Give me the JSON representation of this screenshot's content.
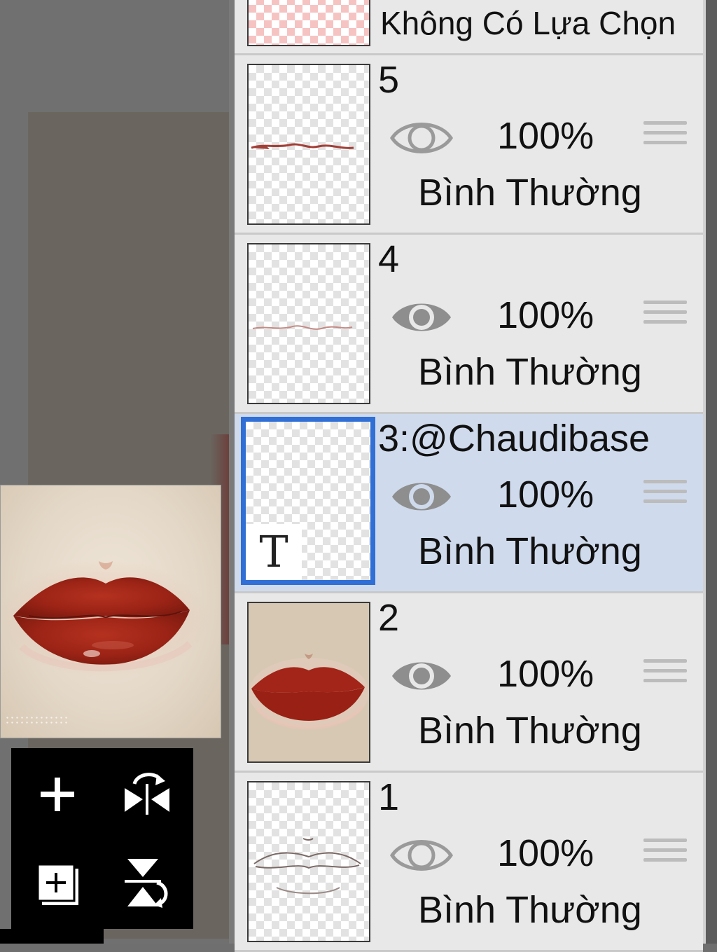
{
  "selection_row": {
    "label": "Không Có Lựa Chọn"
  },
  "layers": [
    {
      "name": "5",
      "opacity": "100%",
      "blend": "Bình Thường",
      "visible": true,
      "eye": "eye-outline-icon",
      "thumb": "lip-line-red"
    },
    {
      "name": "4",
      "opacity": "100%",
      "blend": "Bình Thường",
      "visible": true,
      "eye": "eye-filled-icon",
      "thumb": "lip-line-faint"
    },
    {
      "name": "3:@Chaudibase",
      "opacity": "100%",
      "blend": "Bình Thường",
      "visible": true,
      "eye": "eye-filled-icon",
      "thumb": "text-layer",
      "selected": true,
      "badge": "T"
    },
    {
      "name": "2",
      "opacity": "100%",
      "blend": "Bình Thường",
      "visible": true,
      "eye": "eye-filled-icon",
      "thumb": "lips-painted"
    },
    {
      "name": "1",
      "opacity": "100%",
      "blend": "Bình Thường",
      "visible": true,
      "eye": "eye-outline-icon",
      "thumb": "lip-sketch"
    }
  ],
  "tools": [
    {
      "name": "add-layer-icon"
    },
    {
      "name": "flip-horizontal-icon"
    },
    {
      "name": "add-layer-copy-icon"
    },
    {
      "name": "flip-vertical-icon"
    }
  ],
  "colors": {
    "selection_blue": "#2f6fd6",
    "selected_row": "#cfdaec",
    "row": "#e8e8e8",
    "lip_red": "#a32418"
  }
}
